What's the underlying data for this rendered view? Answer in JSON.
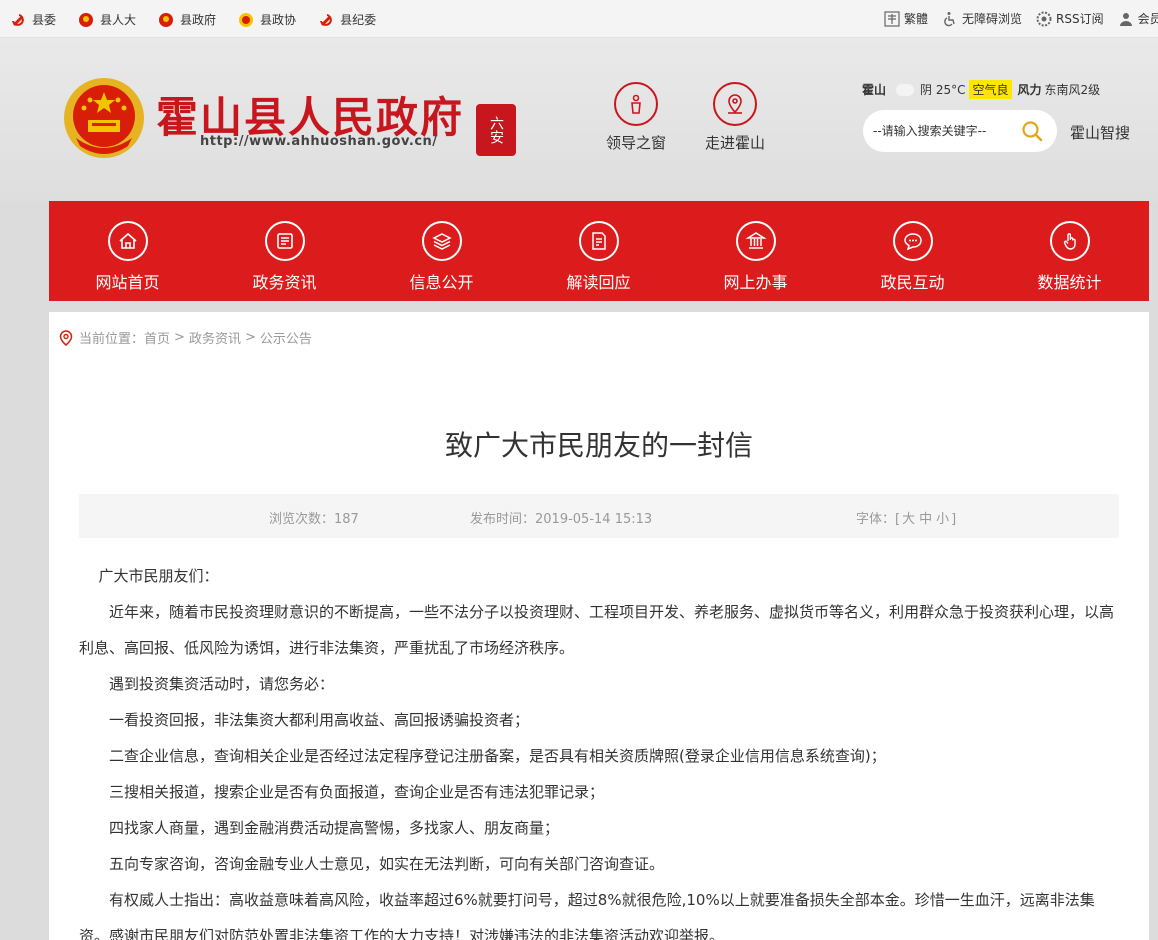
{
  "topbar": {
    "links": [
      "县委",
      "县人大",
      "县政府",
      "县政协",
      "县纪委"
    ],
    "tools": [
      "繁體",
      "无障碍浏览",
      "RSS订阅",
      "会员"
    ]
  },
  "header": {
    "site_title": "霍山县人民政府",
    "site_url": "http://www.ahhuoshan.gov.cn/",
    "seal_text": "六安",
    "nav": [
      {
        "label": "领导之窗",
        "icon": "leader-icon"
      },
      {
        "label": "走进霍山",
        "icon": "location-pin-icon"
      }
    ],
    "weather": {
      "city": "霍山",
      "condition": "阴 25°C",
      "aqi": "空气良",
      "wind_label": "风力",
      "wind": "东南风2级"
    },
    "search_placeholder": "--请输入搜索关键字--",
    "smart_search": "霍山智搜"
  },
  "mainnav": [
    {
      "label": "网站首页",
      "icon": "home-icon"
    },
    {
      "label": "政务资讯",
      "icon": "news-icon"
    },
    {
      "label": "信息公开",
      "icon": "layers-icon"
    },
    {
      "label": "解读回应",
      "icon": "document-edit-icon"
    },
    {
      "label": "网上办事",
      "icon": "building-icon"
    },
    {
      "label": "政民互动",
      "icon": "chat-icon"
    },
    {
      "label": "数据统计",
      "icon": "hand-touch-icon"
    }
  ],
  "breadcrumb": {
    "prefix": "当前位置：",
    "items": [
      "首页",
      "政务资讯",
      "公示公告"
    ],
    "sep": ">"
  },
  "article": {
    "title": "致广大市民朋友的一封信",
    "views_label": "浏览次数：",
    "views": "187",
    "time_label": "发布时间：",
    "time": "2019-05-14 15:13",
    "font_label": "字体：",
    "font_open": "[",
    "font_sizes": [
      "大",
      "中",
      "小"
    ],
    "font_close": "]",
    "paragraphs": [
      "广大市民朋友们：",
      "近年来，随着市民投资理财意识的不断提高，一些不法分子以投资理财、工程项目开发、养老服务、虚拟货币等名义，利用群众急于投资获利心理，以高利息、高回报、低风险为诱饵，进行非法集资，严重扰乱了市场经济秩序。",
      "遇到投资集资活动时，请您务必：",
      "一看投资回报，非法集资大都利用高收益、高回报诱骗投资者；",
      "二查企业信息，查询相关企业是否经过法定程序登记注册备案，是否具有相关资质牌照(登录企业信用信息系统查询)；",
      "三搜相关报道，搜索企业是否有负面报道，查询企业是否有违法犯罪记录；",
      "四找家人商量，遇到金融消费活动提高警惕，多找家人、朋友商量；",
      "五向专家咨询，咨询金融专业人士意见，如实在无法判断，可向有关部门咨询查证。",
      "有权威人士指出：高收益意味着高风险，收益率超过6%就要打问号，超过8%就很危险,10%以上就要准备损失全部本金。珍惜一生血汗，远离非法集资。感谢市民朋友们对防范处置非法集资工作的大力支持！对涉嫌违法的非法集资活动欢迎举报。"
    ]
  },
  "colors": {
    "brand_red": "#c8161e",
    "nav_red": "#dc1c1c",
    "aqi_highlight": "#ffe600",
    "search_icon": "#e8a317"
  }
}
